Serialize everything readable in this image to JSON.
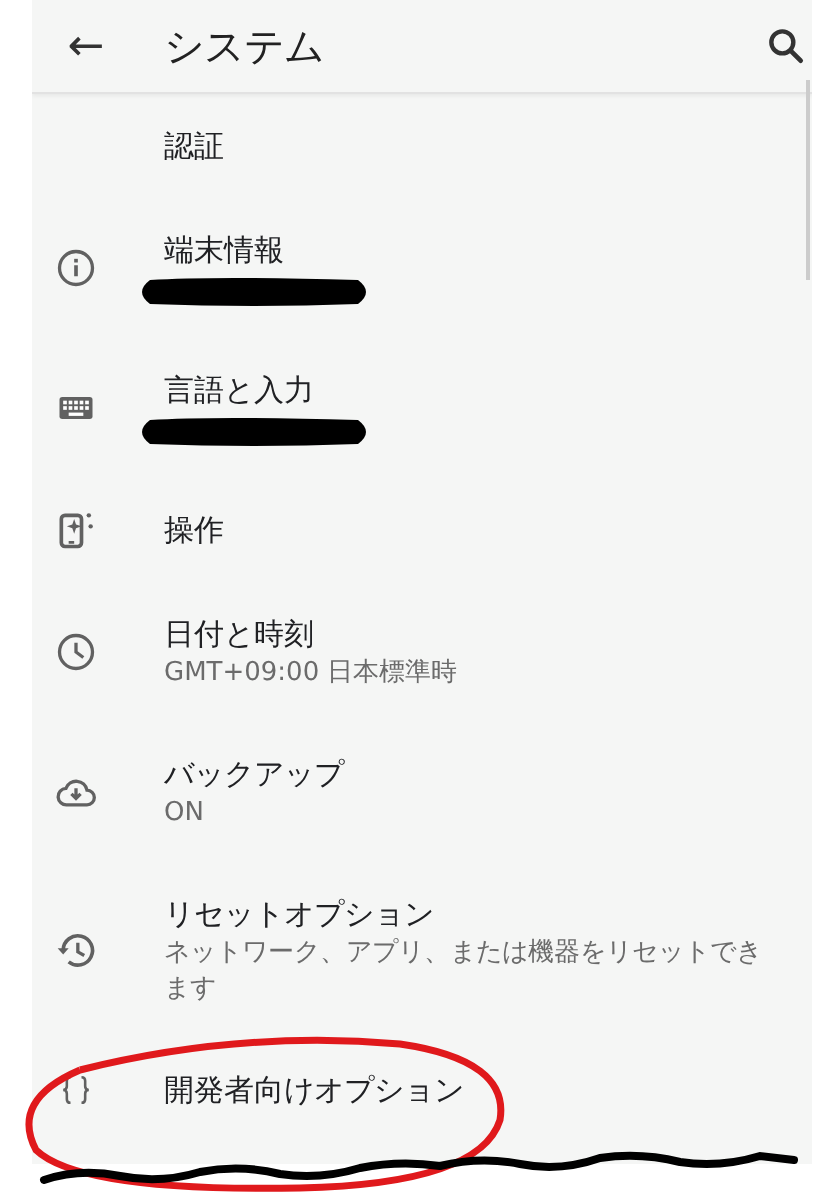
{
  "app_bar": {
    "back": "←",
    "title": "システム"
  },
  "items": [
    {
      "title": "認証",
      "redacted": false
    },
    {
      "title": "端末情報",
      "redacted": true
    },
    {
      "title": "言語と入力",
      "redacted": true
    },
    {
      "title": "操作",
      "redacted": false
    },
    {
      "title": "日付と時刻",
      "subtitle": "GMT+09:00 日本標準時",
      "redacted": false
    },
    {
      "title": "バックアップ",
      "subtitle": "ON",
      "redacted": false
    },
    {
      "title": "リセットオプション",
      "subtitle": "ネットワーク、アプリ、または機器をリセットできます",
      "redacted": false
    },
    {
      "title": "開発者向けオプション",
      "redacted": false
    }
  ]
}
